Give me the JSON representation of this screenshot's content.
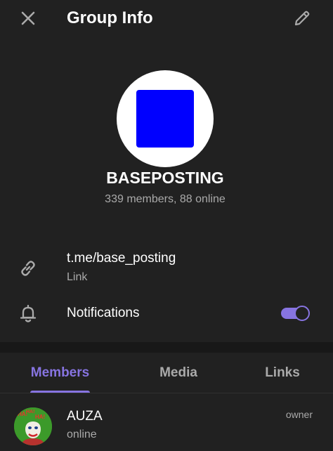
{
  "header": {
    "title": "Group Info",
    "close_icon": "close-icon",
    "edit_icon": "pencil-icon"
  },
  "group": {
    "name": "BASEPOSTING",
    "subtitle": "339 members, 88 online",
    "avatar_color": "#0000ff"
  },
  "info": {
    "link": {
      "value": "t.me/base_posting",
      "label": "Link",
      "icon": "link-icon"
    },
    "notifications": {
      "label": "Notifications",
      "icon": "bell-icon",
      "enabled": true
    }
  },
  "tabs": [
    {
      "label": "Members",
      "active": true
    },
    {
      "label": "Media",
      "active": false
    },
    {
      "label": "Links",
      "active": false
    }
  ],
  "members": [
    {
      "name": "AUZA",
      "status": "online",
      "role": "owner",
      "avatar_bg": "#3c9a2a",
      "avatar_text": "HA!"
    }
  ],
  "colors": {
    "accent": "#8774e1",
    "background": "#212121",
    "secondary_text": "#aaaaaa"
  }
}
